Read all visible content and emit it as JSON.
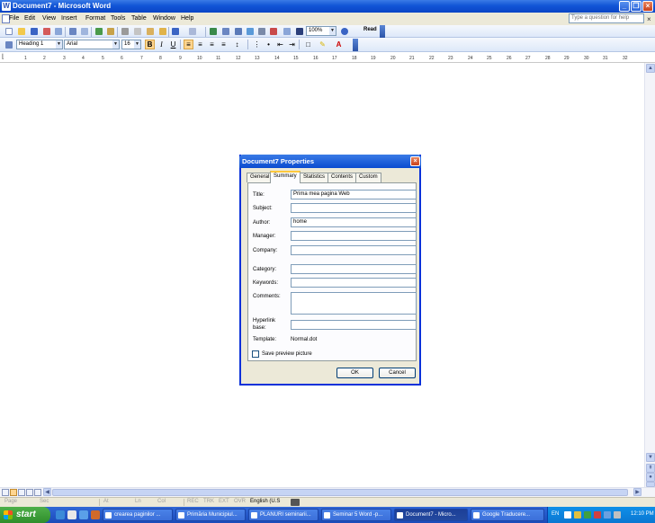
{
  "window": {
    "title": "Document7 - Microsoft Word",
    "app_icon": "W"
  },
  "menu": {
    "items": [
      "File",
      "Edit",
      "View",
      "Insert",
      "Format",
      "Tools",
      "Table",
      "Window",
      "Help"
    ],
    "help_placeholder": "Type a question for help",
    "close_glyph": "×"
  },
  "toolbar": {
    "zoom": "100%",
    "read_label": "Read",
    "style": "Heading 1",
    "font": "Arial",
    "font_size": "16",
    "bold": "B",
    "italic": "I",
    "underline": "U"
  },
  "ruler": {
    "ticks": [
      "1",
      "2",
      "3",
      "4",
      "5",
      "6",
      "7",
      "8",
      "9",
      "10",
      "11",
      "12",
      "13",
      "14",
      "15",
      "16",
      "17",
      "18",
      "19",
      "20",
      "21",
      "22",
      "23",
      "24",
      "25",
      "26",
      "27",
      "28",
      "29",
      "30",
      "31",
      "32"
    ]
  },
  "dialog": {
    "title": "Document7 Properties",
    "tabs": [
      "General",
      "Summary",
      "Statistics",
      "Contents",
      "Custom"
    ],
    "active_tab": "Summary",
    "fields": {
      "title_label": "Title:",
      "title_value": "Prima mea pagina Web",
      "subject_label": "Subject:",
      "subject_value": "",
      "author_label": "Author:",
      "author_value": "home",
      "manager_label": "Manager:",
      "manager_value": "",
      "company_label": "Company:",
      "company_value": "",
      "category_label": "Category:",
      "category_value": "",
      "keywords_label": "Keywords:",
      "keywords_value": "",
      "comments_label": "Comments:",
      "comments_value": "",
      "hyperlink_label_1": "Hyperlink",
      "hyperlink_label_2": "base:",
      "hyperlink_value": "",
      "template_label": "Template:",
      "template_value": "Normal.dot"
    },
    "save_preview_label": "Save preview picture",
    "save_preview_checked": false,
    "ok_label": "OK",
    "cancel_label": "Cancel"
  },
  "status": {
    "page": "Page",
    "sec": "Sec",
    "at": "At",
    "ln": "Ln",
    "col": "Col",
    "rec": "REC",
    "trk": "TRK",
    "ext": "EXT",
    "ovr": "OVR",
    "language": "English (U.S"
  },
  "taskbar": {
    "start_label": "start",
    "tasks": [
      {
        "label": "crearea paginilor ..."
      },
      {
        "label": "Primăria Municipiul..."
      },
      {
        "label": "PLANURI seminarii..."
      },
      {
        "label": "Seminar 5 Word -p..."
      },
      {
        "label": "Document7 - Micro..."
      },
      {
        "label": "Google Traducere..."
      }
    ],
    "active_task": "Document7 - Micro...",
    "language": "EN",
    "clock": "12:10 PM"
  }
}
